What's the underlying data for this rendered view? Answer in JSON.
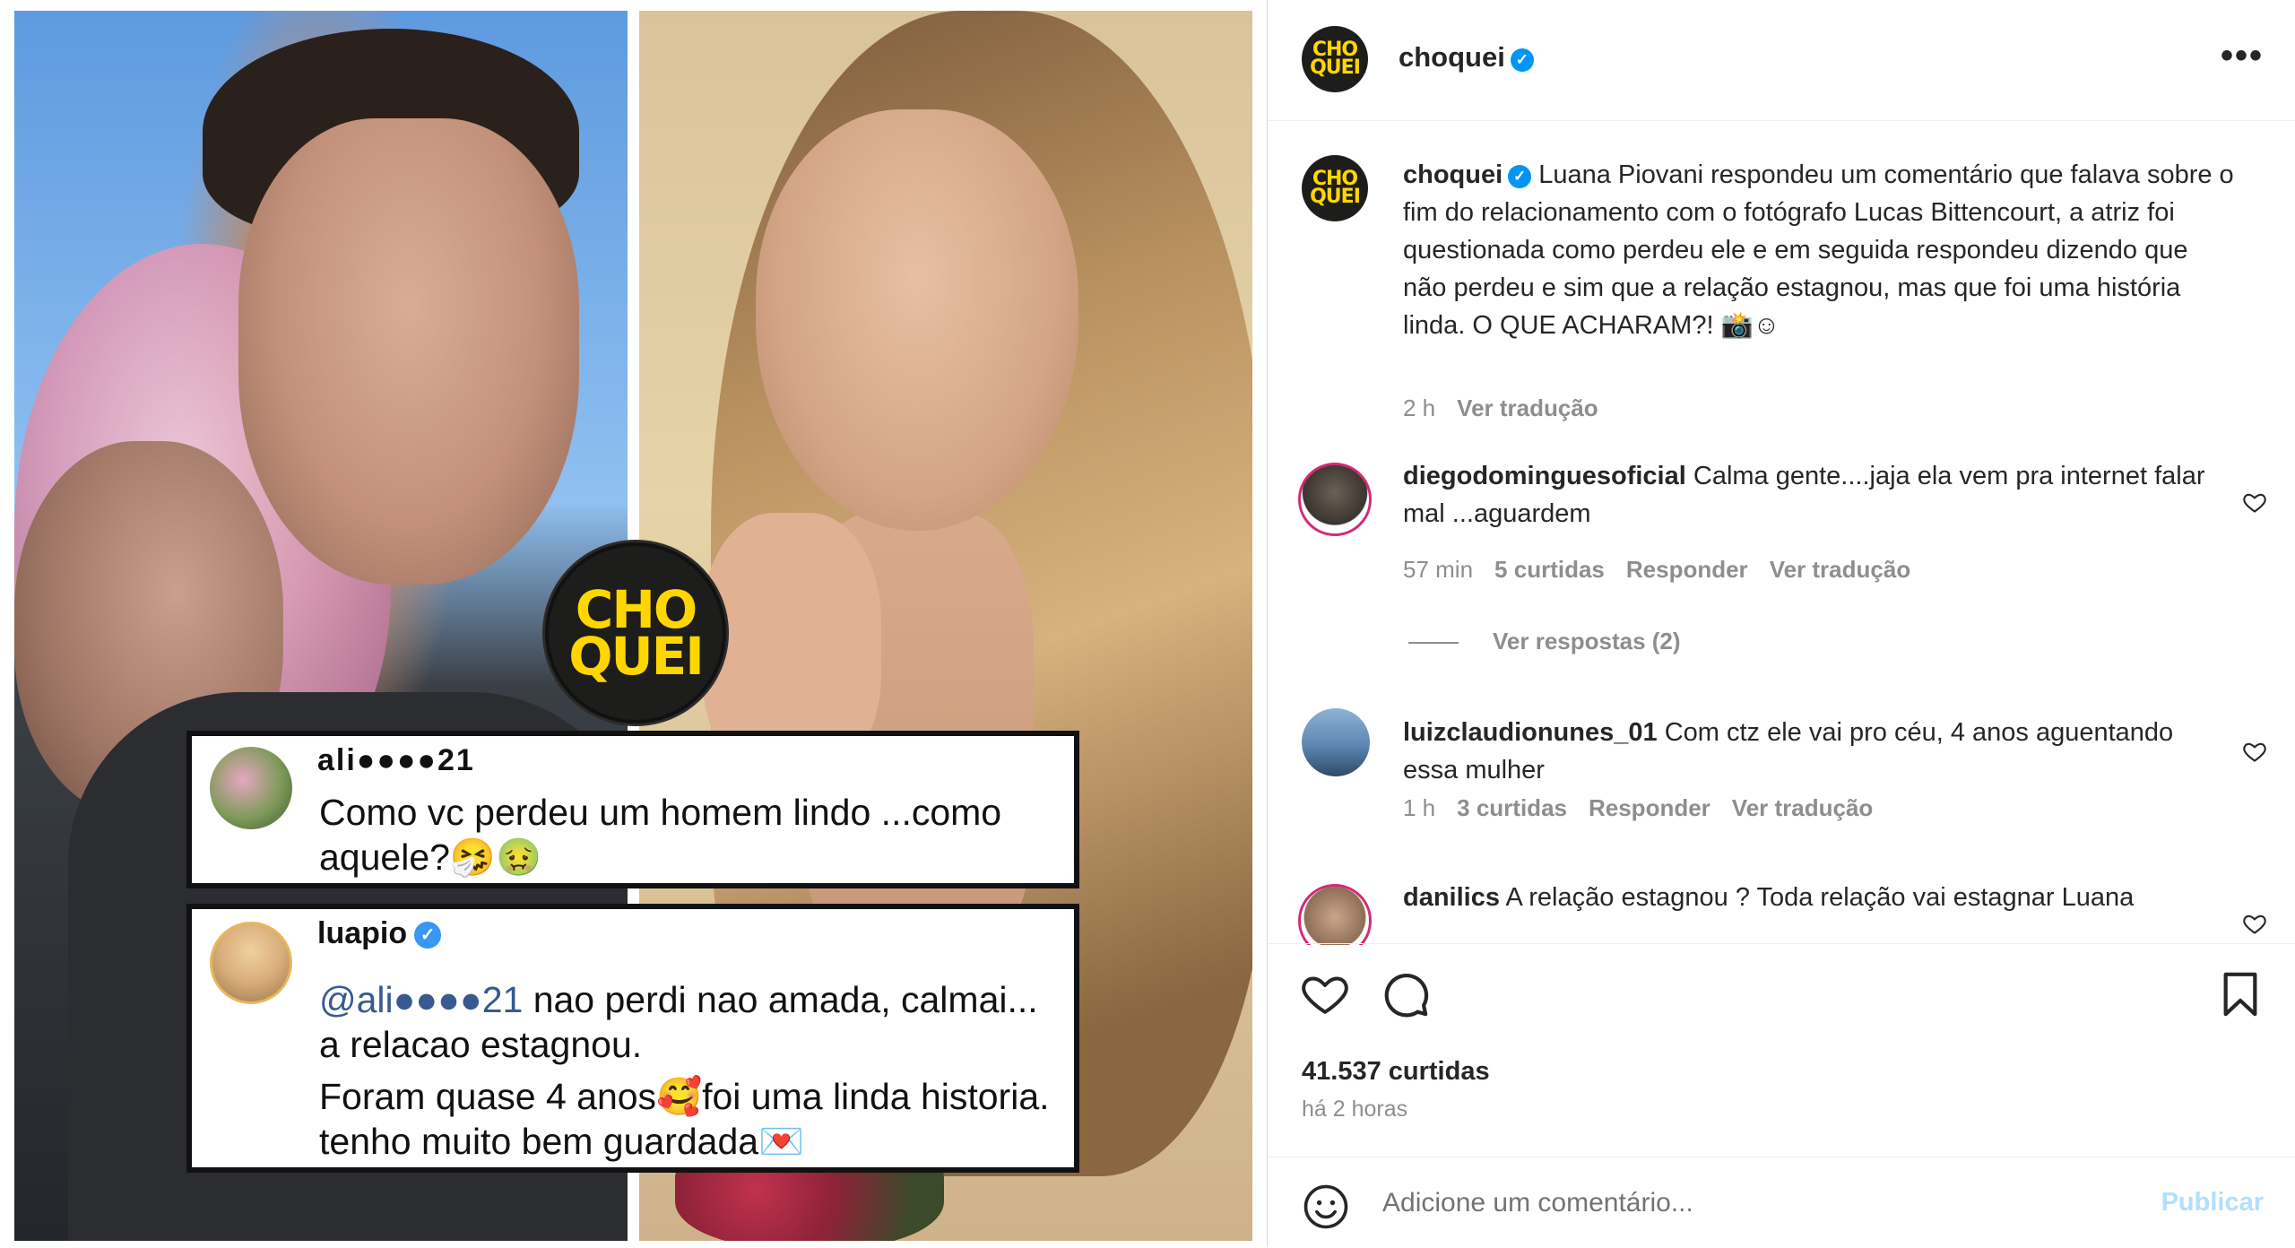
{
  "image": {
    "logo_text_line1": "CHO",
    "logo_text_line2": "QUEI",
    "card1": {
      "username": "ali●●●●21",
      "text": "Como vc perdeu um homem lindo ...como aquele?🤧🤢"
    },
    "card2": {
      "username": "luapio",
      "mention": "@ali●●●●21",
      "text_a": " nao perdi nao amada, calmai... a relacao estagnou.",
      "text_b": "Foram quase 4 anos🥰foi uma linda historia. tenho muito bem guardada💌"
    }
  },
  "header": {
    "username": "choquei",
    "verified_icon": "verified-badge-icon",
    "more_icon": "more-options-icon",
    "more_glyph": "•••"
  },
  "caption": {
    "username": "choquei",
    "text": "Luana Piovani respondeu um comentário que falava sobre o fim do relacionamento com o fotógrafo Lucas Bittencourt, a atriz foi questionada como perdeu ele e em seguida respondeu dizendo que não perdeu e sim que a relação estagnou, mas que foi uma história linda. O QUE ACHARAM?! 📸☺",
    "time": "2 h",
    "translate": "Ver tradução"
  },
  "comments": [
    {
      "username": "diegodominguesoficial",
      "text": "Calma gente....jaja ela vem pra internet falar mal ...aguardem",
      "time": "57 min",
      "likes": "5 curtidas",
      "reply": "Responder",
      "translate": "Ver tradução",
      "view_replies": "Ver respostas (2)"
    },
    {
      "username": "luizclaudionunes_01",
      "text": "Com ctz ele vai pro céu, 4 anos aguentando essa mulher",
      "time": "1 h",
      "likes": "3 curtidas",
      "reply": "Responder",
      "translate": "Ver tradução"
    },
    {
      "username": "danilics",
      "text": "A relação estagnou ? Toda relação vai estagnar Luana"
    }
  ],
  "actions": {
    "like_icon": "heart-icon",
    "comment_icon": "comment-icon",
    "save_icon": "bookmark-icon",
    "likes_count": "41.537 curtidas",
    "posted_time": "há 2 horas"
  },
  "add_comment": {
    "emoji_icon": "smiley-icon",
    "placeholder": "Adicione um comentário...",
    "post_label": "Publicar"
  },
  "colors": {
    "verified": "#0095f6",
    "logo_bg": "#1d1d1b",
    "logo_text": "#ffd600",
    "muted_text": "#8e8e8e",
    "publish_disabled": "#b2dffc"
  }
}
